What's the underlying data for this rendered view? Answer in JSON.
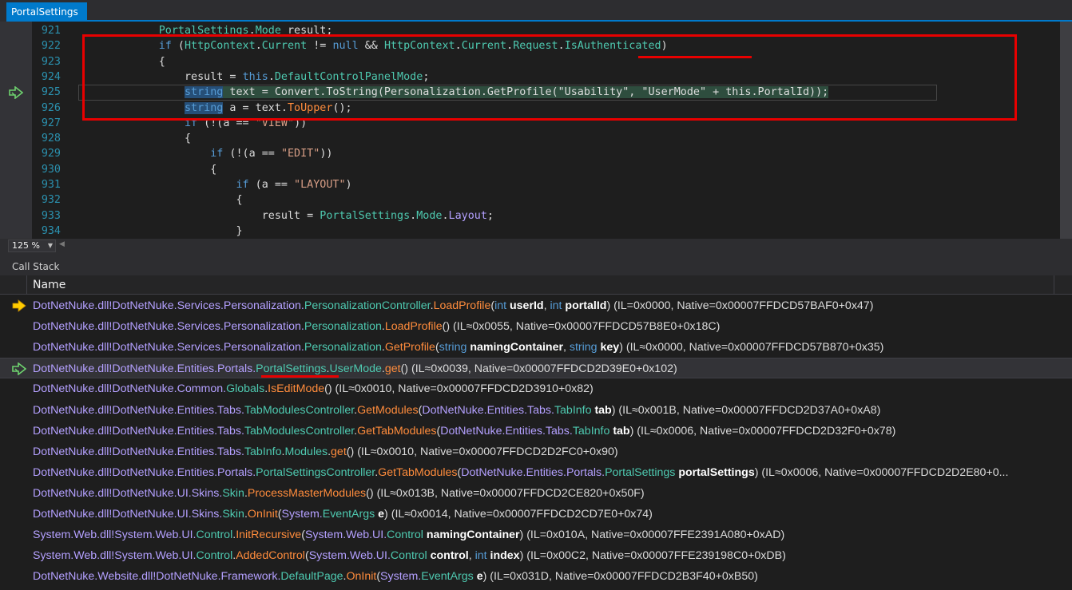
{
  "editor": {
    "tab_title": "PortalSettings",
    "zoom_level": "125 %",
    "lines": [
      {
        "num": "921",
        "indent": "            ",
        "tokens": [
          [
            "ty",
            "PortalSettings"
          ],
          [
            "dot",
            "."
          ],
          [
            "ty",
            "Mode"
          ],
          [
            "pl",
            " result;"
          ]
        ]
      },
      {
        "num": "922",
        "indent": "            ",
        "tokens": [
          [
            "kw",
            "if"
          ],
          [
            "pl",
            " ("
          ],
          [
            "ty",
            "HttpContext"
          ],
          [
            "dot",
            "."
          ],
          [
            "ty",
            "Current"
          ],
          [
            "pl",
            " != "
          ],
          [
            "kw",
            "null"
          ],
          [
            "pl",
            " && "
          ],
          [
            "ty",
            "HttpContext"
          ],
          [
            "dot",
            "."
          ],
          [
            "ty",
            "Current"
          ],
          [
            "dot",
            "."
          ],
          [
            "ty",
            "Request"
          ],
          [
            "dot",
            "."
          ],
          [
            "ty",
            "IsAuthenticated"
          ],
          [
            "pl",
            ")"
          ]
        ]
      },
      {
        "num": "923",
        "indent": "            ",
        "tokens": [
          [
            "pl",
            "{"
          ]
        ]
      },
      {
        "num": "924",
        "indent": "                ",
        "tokens": [
          [
            "pl",
            "result = "
          ],
          [
            "kw",
            "this"
          ],
          [
            "dot",
            "."
          ],
          [
            "ty",
            "DefaultControlPanelMode"
          ],
          [
            "pl",
            ";"
          ]
        ]
      },
      {
        "num": "925",
        "indent": "                ",
        "current": true,
        "tokens": [
          [
            "kw hlkw",
            "string"
          ],
          [
            "pl hlnext",
            " text = Convert.ToString(Personalization.GetProfile(\"Usability\", \"UserMode\" + this.PortalId));"
          ]
        ]
      },
      {
        "num": "926",
        "indent": "                ",
        "tokens": [
          [
            "kw hlkw",
            "string"
          ],
          [
            "pl",
            " a = text."
          ],
          [
            "mth",
            "ToUpper"
          ],
          [
            "pl",
            "();"
          ]
        ]
      },
      {
        "num": "927",
        "indent": "                ",
        "tokens": [
          [
            "kw",
            "if"
          ],
          [
            "pl",
            " (!(a == "
          ],
          [
            "str",
            "\"VIEW\""
          ],
          [
            "pl",
            "))"
          ]
        ]
      },
      {
        "num": "928",
        "indent": "                ",
        "tokens": [
          [
            "pl",
            "{"
          ]
        ]
      },
      {
        "num": "929",
        "indent": "                    ",
        "tokens": [
          [
            "kw",
            "if"
          ],
          [
            "pl",
            " (!(a == "
          ],
          [
            "str",
            "\"EDIT\""
          ],
          [
            "pl",
            "))"
          ]
        ]
      },
      {
        "num": "930",
        "indent": "                    ",
        "tokens": [
          [
            "pl",
            "{"
          ]
        ]
      },
      {
        "num": "931",
        "indent": "                        ",
        "tokens": [
          [
            "kw",
            "if"
          ],
          [
            "pl",
            " (a == "
          ],
          [
            "str",
            "\"LAYOUT\""
          ],
          [
            "pl",
            ")"
          ]
        ]
      },
      {
        "num": "932",
        "indent": "                        ",
        "tokens": [
          [
            "pl",
            "{"
          ]
        ]
      },
      {
        "num": "933",
        "indent": "                            ",
        "tokens": [
          [
            "pl",
            "result = "
          ],
          [
            "ty",
            "PortalSettings"
          ],
          [
            "dot",
            "."
          ],
          [
            "ty",
            "Mode"
          ],
          [
            "dot",
            "."
          ],
          [
            "prop",
            "Layout"
          ],
          [
            "pl",
            ";"
          ]
        ]
      },
      {
        "num": "934",
        "indent": "                        ",
        "tokens": [
          [
            "pl",
            "}"
          ]
        ]
      }
    ]
  },
  "callstack": {
    "title": "Call Stack",
    "column_name": "Name",
    "rows": [
      {
        "icon": "current-frame-arrow-icon",
        "tokens": [
          [
            "mod",
            "DotNetNuke.dll!"
          ],
          [
            "ns",
            "DotNetNuke.Services.Personalization."
          ],
          [
            "tn",
            "PersonalizationController"
          ],
          [
            "dot",
            "."
          ],
          [
            "fn",
            "LoadProfile"
          ],
          [
            "pl",
            "("
          ],
          [
            "pk",
            "int"
          ],
          [
            "pn",
            " userId"
          ],
          [
            "pl",
            ", "
          ],
          [
            "pk",
            "int"
          ],
          [
            "pn",
            " portalId"
          ],
          [
            "pl",
            ") "
          ],
          [
            "il",
            "(IL=0x0000, Native=0x00007FFDCD57BAF0+0x47)"
          ]
        ]
      },
      {
        "icon": "",
        "tokens": [
          [
            "mod",
            "DotNetNuke.dll!"
          ],
          [
            "ns",
            "DotNetNuke.Services.Personalization."
          ],
          [
            "tn",
            "Personalization"
          ],
          [
            "dot",
            "."
          ],
          [
            "fn",
            "LoadProfile"
          ],
          [
            "pl",
            "() "
          ],
          [
            "il",
            "(IL≈0x0055, Native=0x00007FFDCD57B8E0+0x18C)"
          ]
        ]
      },
      {
        "icon": "",
        "tokens": [
          [
            "mod",
            "DotNetNuke.dll!"
          ],
          [
            "ns",
            "DotNetNuke.Services.Personalization."
          ],
          [
            "tn",
            "Personalization"
          ],
          [
            "dot",
            "."
          ],
          [
            "fn",
            "GetProfile"
          ],
          [
            "pl",
            "("
          ],
          [
            "pk",
            "string"
          ],
          [
            "pn",
            " namingContainer"
          ],
          [
            "pl",
            ", "
          ],
          [
            "pk",
            "string"
          ],
          [
            "pn",
            " key"
          ],
          [
            "pl",
            ") "
          ],
          [
            "il",
            "(IL≈0x0000, Native=0x00007FFDCD57B870+0x35)"
          ]
        ]
      },
      {
        "icon": "return-point-arrow-icon",
        "selected": true,
        "tokens": [
          [
            "mod",
            "DotNetNuke.dll!"
          ],
          [
            "ns",
            "DotNetNuke.Entities.Portals."
          ],
          [
            "tn",
            "PortalSettings"
          ],
          [
            "dot",
            "."
          ],
          [
            "tn",
            "UserMode"
          ],
          [
            "dot",
            "."
          ],
          [
            "fn",
            "get"
          ],
          [
            "pl",
            "() "
          ],
          [
            "il",
            "(IL≈0x0039, Native=0x00007FFDCD2D39E0+0x102)"
          ]
        ]
      },
      {
        "icon": "",
        "tokens": [
          [
            "mod",
            "DotNetNuke.dll!"
          ],
          [
            "ns",
            "DotNetNuke.Common."
          ],
          [
            "tn",
            "Globals"
          ],
          [
            "dot",
            "."
          ],
          [
            "fn",
            "IsEditMode"
          ],
          [
            "pl",
            "() "
          ],
          [
            "il",
            "(IL≈0x0010, Native=0x00007FFDCD2D3910+0x82)"
          ]
        ]
      },
      {
        "icon": "",
        "tokens": [
          [
            "mod",
            "DotNetNuke.dll!"
          ],
          [
            "ns",
            "DotNetNuke.Entities.Tabs."
          ],
          [
            "tn",
            "TabModulesController"
          ],
          [
            "dot",
            "."
          ],
          [
            "fn",
            "GetModules"
          ],
          [
            "pl",
            "("
          ],
          [
            "ns",
            "DotNetNuke.Entities.Tabs."
          ],
          [
            "tn",
            "TabInfo"
          ],
          [
            "pn",
            " tab"
          ],
          [
            "pl",
            ") "
          ],
          [
            "il",
            "(IL≈0x001B, Native=0x00007FFDCD2D37A0+0xA8)"
          ]
        ]
      },
      {
        "icon": "",
        "tokens": [
          [
            "mod",
            "DotNetNuke.dll!"
          ],
          [
            "ns",
            "DotNetNuke.Entities.Tabs."
          ],
          [
            "tn",
            "TabModulesController"
          ],
          [
            "dot",
            "."
          ],
          [
            "fn",
            "GetTabModules"
          ],
          [
            "pl",
            "("
          ],
          [
            "ns",
            "DotNetNuke.Entities.Tabs."
          ],
          [
            "tn",
            "TabInfo"
          ],
          [
            "pn",
            " tab"
          ],
          [
            "pl",
            ") "
          ],
          [
            "il",
            "(IL≈0x0006, Native=0x00007FFDCD2D32F0+0x78)"
          ]
        ]
      },
      {
        "icon": "",
        "tokens": [
          [
            "mod",
            "DotNetNuke.dll!"
          ],
          [
            "ns",
            "DotNetNuke.Entities.Tabs."
          ],
          [
            "tn",
            "TabInfo"
          ],
          [
            "dot",
            "."
          ],
          [
            "tn",
            "Modules"
          ],
          [
            "dot",
            "."
          ],
          [
            "fn",
            "get"
          ],
          [
            "pl",
            "() "
          ],
          [
            "il",
            "(IL≈0x0010, Native=0x00007FFDCD2D2FC0+0x90)"
          ]
        ]
      },
      {
        "icon": "",
        "tokens": [
          [
            "mod",
            "DotNetNuke.dll!"
          ],
          [
            "ns",
            "DotNetNuke.Entities.Portals."
          ],
          [
            "tn",
            "PortalSettingsController"
          ],
          [
            "dot",
            "."
          ],
          [
            "fn",
            "GetTabModules"
          ],
          [
            "pl",
            "("
          ],
          [
            "ns",
            "DotNetNuke.Entities.Portals."
          ],
          [
            "tn",
            "PortalSettings"
          ],
          [
            "pn",
            " portalSettings"
          ],
          [
            "pl",
            ") "
          ],
          [
            "il",
            "(IL≈0x0006, Native=0x00007FFDCD2D2E80+0..."
          ]
        ]
      },
      {
        "icon": "",
        "tokens": [
          [
            "mod",
            "DotNetNuke.dll!"
          ],
          [
            "ns",
            "DotNetNuke.UI.Skins."
          ],
          [
            "tn",
            "Skin"
          ],
          [
            "dot",
            "."
          ],
          [
            "fn",
            "ProcessMasterModules"
          ],
          [
            "pl",
            "() "
          ],
          [
            "il",
            "(IL≈0x013B, Native=0x00007FFDCD2CE820+0x50F)"
          ]
        ]
      },
      {
        "icon": "",
        "tokens": [
          [
            "mod",
            "DotNetNuke.dll!"
          ],
          [
            "ns",
            "DotNetNuke.UI.Skins."
          ],
          [
            "tn",
            "Skin"
          ],
          [
            "dot",
            "."
          ],
          [
            "fn",
            "OnInit"
          ],
          [
            "pl",
            "("
          ],
          [
            "ns",
            "System."
          ],
          [
            "tn",
            "EventArgs"
          ],
          [
            "pn",
            " e"
          ],
          [
            "pl",
            ") "
          ],
          [
            "il",
            "(IL≈0x0014, Native=0x00007FFDCD2CD7E0+0x74)"
          ]
        ]
      },
      {
        "icon": "",
        "tokens": [
          [
            "mod",
            "System.Web.dll!"
          ],
          [
            "ns",
            "System.Web.UI."
          ],
          [
            "tn",
            "Control"
          ],
          [
            "dot",
            "."
          ],
          [
            "fn",
            "InitRecursive"
          ],
          [
            "pl",
            "("
          ],
          [
            "ns",
            "System.Web.UI."
          ],
          [
            "tn",
            "Control"
          ],
          [
            "pn",
            " namingContainer"
          ],
          [
            "pl",
            ") "
          ],
          [
            "il",
            "(IL=0x010A, Native=0x00007FFE2391A080+0xAD)"
          ]
        ]
      },
      {
        "icon": "",
        "tokens": [
          [
            "mod",
            "System.Web.dll!"
          ],
          [
            "ns",
            "System.Web.UI."
          ],
          [
            "tn",
            "Control"
          ],
          [
            "dot",
            "."
          ],
          [
            "fn",
            "AddedControl"
          ],
          [
            "pl",
            "("
          ],
          [
            "ns",
            "System.Web.UI."
          ],
          [
            "tn",
            "Control"
          ],
          [
            "pn",
            " control"
          ],
          [
            "pl",
            ", "
          ],
          [
            "pk",
            "int"
          ],
          [
            "pn",
            " index"
          ],
          [
            "pl",
            ") "
          ],
          [
            "il",
            "(IL=0x00C2, Native=0x00007FFE239198C0+0xDB)"
          ]
        ]
      },
      {
        "icon": "",
        "tokens": [
          [
            "mod",
            "DotNetNuke.Website.dll!"
          ],
          [
            "ns",
            "DotNetNuke.Framework."
          ],
          [
            "tn",
            "DefaultPage"
          ],
          [
            "dot",
            "."
          ],
          [
            "fn",
            "OnInit"
          ],
          [
            "pl",
            "("
          ],
          [
            "ns",
            "System."
          ],
          [
            "tn",
            "EventArgs"
          ],
          [
            "pn",
            " e"
          ],
          [
            "pl",
            ") "
          ],
          [
            "il",
            "(IL=0x031D, Native=0x00007FFDCD2B3F40+0xB50)"
          ]
        ]
      }
    ]
  }
}
